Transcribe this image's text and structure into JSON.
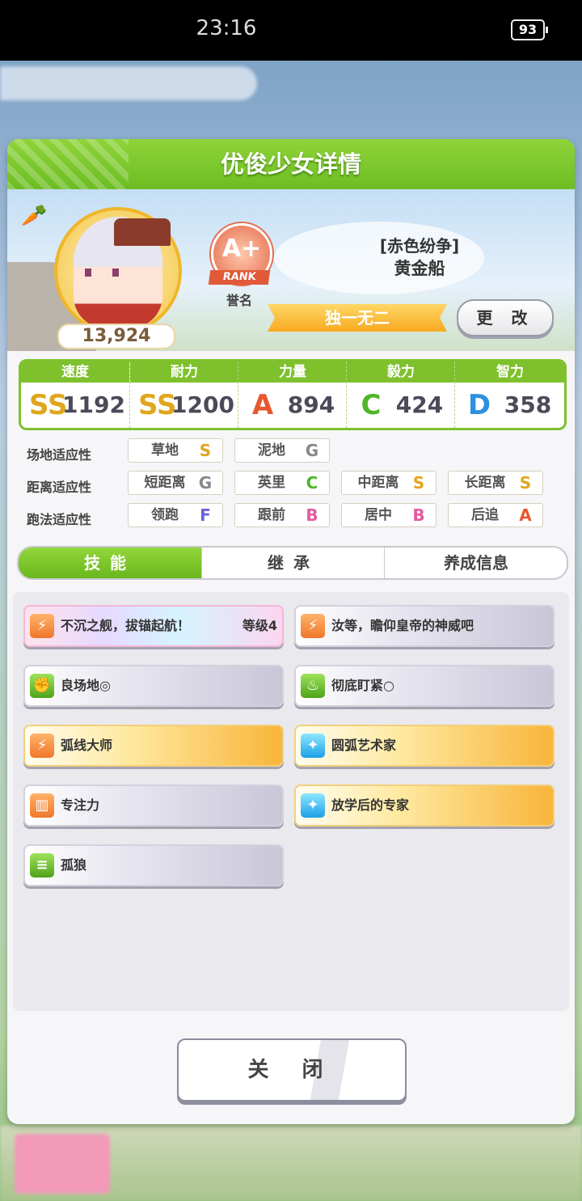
{
  "status_bar": {
    "time": "23:16",
    "battery": "93"
  },
  "dialog": {
    "title": "优俊少女详情",
    "profile": {
      "fans": "13,924",
      "rank": {
        "grade": "A+",
        "ribbon": "RANK",
        "label": "誉名"
      },
      "epithet": "[赤色纷争]",
      "name": "黄金船",
      "title_badge": "独一无二",
      "change_label": "更 改"
    },
    "stats": [
      {
        "label": "速度",
        "icon": "shoe-icon",
        "grade": "SS",
        "value": "1192",
        "color": "#e0a61c"
      },
      {
        "label": "耐力",
        "icon": "heart-icon",
        "grade": "SS",
        "value": "1200",
        "color": "#e0a61c"
      },
      {
        "label": "力量",
        "icon": "muscle-icon",
        "grade": "A",
        "value": "894",
        "color": "#e8572e"
      },
      {
        "label": "毅力",
        "icon": "flame-icon",
        "grade": "C",
        "value": "424",
        "color": "#4fb52a"
      },
      {
        "label": "智力",
        "icon": "mortarboard-icon",
        "grade": "D",
        "value": "358",
        "color": "#2f8fe0"
      }
    ],
    "aptitudes": {
      "field": {
        "label": "场地适应性",
        "items": [
          {
            "name": "草地",
            "grade": "S"
          },
          {
            "name": "泥地",
            "grade": "G"
          }
        ]
      },
      "distance": {
        "label": "距离适应性",
        "items": [
          {
            "name": "短距离",
            "grade": "G"
          },
          {
            "name": "英里",
            "grade": "C"
          },
          {
            "name": "中距离",
            "grade": "S"
          },
          {
            "name": "长距离",
            "grade": "S"
          }
        ]
      },
      "style": {
        "label": "跑法适应性",
        "items": [
          {
            "name": "领跑",
            "grade": "F"
          },
          {
            "name": "跟前",
            "grade": "B"
          },
          {
            "name": "居中",
            "grade": "B"
          },
          {
            "name": "后追",
            "grade": "A"
          }
        ]
      }
    },
    "tabs": [
      "技能",
      "继承",
      "养成信息"
    ],
    "skills": [
      {
        "name": "不沉之舰，拔锚起航！",
        "level": "等级4",
        "style": "rainbow",
        "icon": "runner-icon",
        "icon_color": "orange"
      },
      {
        "name": "汝等，瞻仰皇帝的神威吧",
        "level": "",
        "style": "plain",
        "icon": "runner-icon",
        "icon_color": "orange"
      },
      {
        "name": "良场地◎",
        "level": "",
        "style": "plain",
        "icon": "muscle-icon",
        "icon_color": "green"
      },
      {
        "name": "彻底盯紧○",
        "level": "",
        "style": "plain",
        "icon": "flame-icon",
        "icon_color": "green"
      },
      {
        "name": "弧线大师",
        "level": "",
        "style": "gold",
        "icon": "runner-icon",
        "icon_color": "orange"
      },
      {
        "name": "圆弧艺术家",
        "level": "",
        "style": "gold",
        "icon": "sparkle-icon",
        "icon_color": "blue"
      },
      {
        "name": "专注力",
        "level": "",
        "style": "plain",
        "icon": "gate-icon",
        "icon_color": "orange"
      },
      {
        "name": "放学后的专家",
        "level": "",
        "style": "gold",
        "icon": "sparkle-icon",
        "icon_color": "blue"
      },
      {
        "name": "孤狼",
        "level": "",
        "style": "plain",
        "icon": "speed-lines-icon",
        "icon_color": "green"
      }
    ],
    "close_label": "关 闭"
  }
}
